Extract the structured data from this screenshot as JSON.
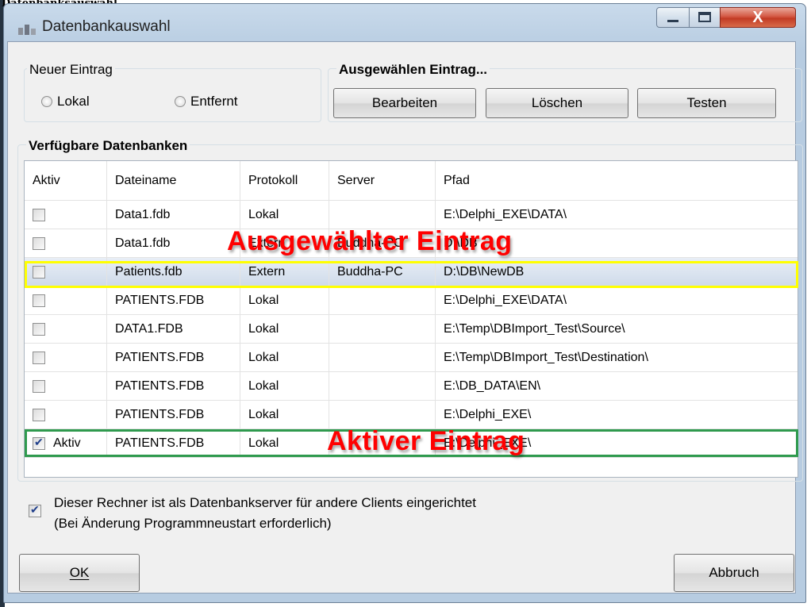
{
  "doc_label": "Datenbanksauswahl",
  "window": {
    "title": "Datenbankauswahl",
    "close_glyph": "X"
  },
  "new_entry": {
    "label": "Neuer Eintrag",
    "local": "Lokal",
    "remote": "Entfernt"
  },
  "selected_entry": {
    "label": "Ausgewählen Eintrag...",
    "edit": "Bearbeiten",
    "delete": "Löschen",
    "test": "Testen"
  },
  "databases": {
    "label": "Verfügbare Datenbanken",
    "columns": [
      "Aktiv",
      "Dateiname",
      "Protokoll",
      "Server",
      "Pfad"
    ],
    "rows": [
      {
        "active": false,
        "active_label": "",
        "file": "Data1.fdb",
        "protocol": "Lokal",
        "server": "",
        "path": "E:\\Delphi_EXE\\DATA\\"
      },
      {
        "active": false,
        "active_label": "",
        "file": "Data1.fdb",
        "protocol": "Extern",
        "server": "Buddha-PC",
        "path": "D:\\DB"
      },
      {
        "active": false,
        "active_label": "",
        "file": "Patients.fdb",
        "protocol": "Extern",
        "server": "Buddha-PC",
        "path": "D:\\DB\\NewDB",
        "selected": true
      },
      {
        "active": false,
        "active_label": "",
        "file": "PATIENTS.FDB",
        "protocol": "Lokal",
        "server": "",
        "path": "E:\\Delphi_EXE\\DATA\\"
      },
      {
        "active": false,
        "active_label": "",
        "file": "DATA1.FDB",
        "protocol": "Lokal",
        "server": "",
        "path": "E:\\Temp\\DBImport_Test\\Source\\"
      },
      {
        "active": false,
        "active_label": "",
        "file": "PATIENTS.FDB",
        "protocol": "Lokal",
        "server": "",
        "path": "E:\\Temp\\DBImport_Test\\Destination\\"
      },
      {
        "active": false,
        "active_label": "",
        "file": "PATIENTS.FDB",
        "protocol": "Lokal",
        "server": "",
        "path": "E:\\DB_DATA\\EN\\"
      },
      {
        "active": false,
        "active_label": "",
        "file": "PATIENTS.FDB",
        "protocol": "Lokal",
        "server": "",
        "path": "E:\\Delphi_EXE\\"
      },
      {
        "active": true,
        "active_label": "Aktiv",
        "file": "PATIENTS.FDB",
        "protocol": "Lokal",
        "server": "",
        "path": "E:\\Delphi_EXE\\"
      }
    ]
  },
  "annotations": {
    "selected": "Ausgewählter Eintrag",
    "active": "Aktiver Eintrag"
  },
  "server_option": {
    "checked": true,
    "line1": "Dieser Rechner ist als Datenbankserver für andere Clients eingerichtet",
    "line2": "(Bei Änderung Programmneustart erforderlich)"
  },
  "footer": {
    "ok": "OK",
    "cancel": "Abbruch"
  },
  "colors": {
    "annotation": "#ff0000",
    "selected_box": "#ffff00",
    "active_box": "#2f9a4e"
  }
}
